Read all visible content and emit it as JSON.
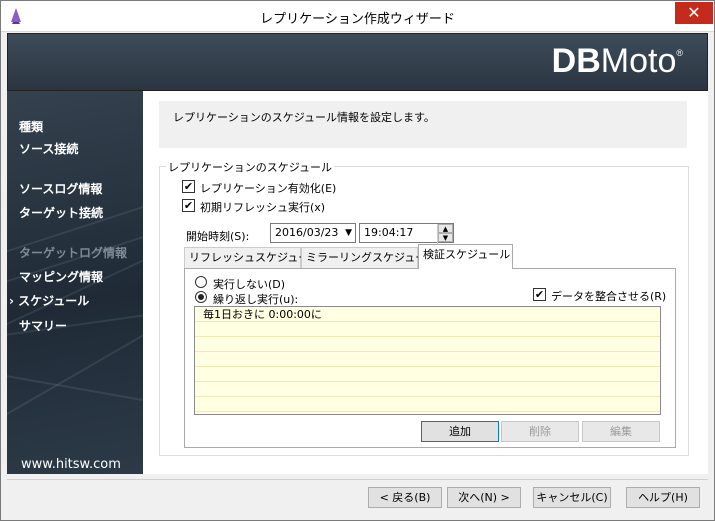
{
  "window": {
    "title": "レプリケーション作成ウィザード",
    "close_glyph": "✕"
  },
  "banner": {
    "logo_bold": "DB",
    "logo_rest": "Moto",
    "logo_mark": "®"
  },
  "sidebar": {
    "items": [
      {
        "label": "種類",
        "state": "normal"
      },
      {
        "label": "ソース接続",
        "state": "normal"
      },
      {
        "label": "ソースログ情報",
        "state": "normal"
      },
      {
        "label": "ターゲット接続",
        "state": "normal"
      },
      {
        "label": "ターゲットログ情報",
        "state": "disabled"
      },
      {
        "label": "マッピング情報",
        "state": "normal"
      },
      {
        "label": "スケジュール",
        "state": "current",
        "marker": "›"
      },
      {
        "label": "サマリー",
        "state": "normal"
      }
    ],
    "url": "www.hitsw.com"
  },
  "content": {
    "info": "レプリケーションのスケジュール情報を設定します。",
    "group_title": "レプリケーションのスケジュール",
    "enable_replication": {
      "label": "レプリケーション有効化(E)",
      "checked": true
    },
    "initial_refresh": {
      "label": "初期リフレッシュ実行(x)",
      "checked": true
    },
    "start_time_label": "開始時刻(S):",
    "start_date": "2016/03/23",
    "start_time": "19:04:17",
    "tabs": [
      {
        "label": "リフレッシュスケジュール",
        "active": false
      },
      {
        "label": "ミラーリングスケジュール",
        "active": false
      },
      {
        "label": "検証スケジュール",
        "active": true
      }
    ],
    "radio_not_run": {
      "label": "実行しない(D)",
      "selected": false
    },
    "radio_repeat": {
      "label": "繰り返し実行(u):",
      "selected": true
    },
    "reconcile": {
      "label": "データを整合させる(R)",
      "checked": true
    },
    "schedule_rows": [
      "毎1日おきに 0:00:00に"
    ],
    "buttons": {
      "add": "追加",
      "delete": "削除",
      "edit": "編集"
    },
    "check_glyph": "✔",
    "dropdown_glyph": "▼",
    "spin_up": "▲",
    "spin_down": "▼"
  },
  "footer": {
    "back": "< 戻る(B)",
    "next": "次へ(N) >",
    "cancel": "キャンセル(C)",
    "help": "ヘルプ(H)"
  }
}
